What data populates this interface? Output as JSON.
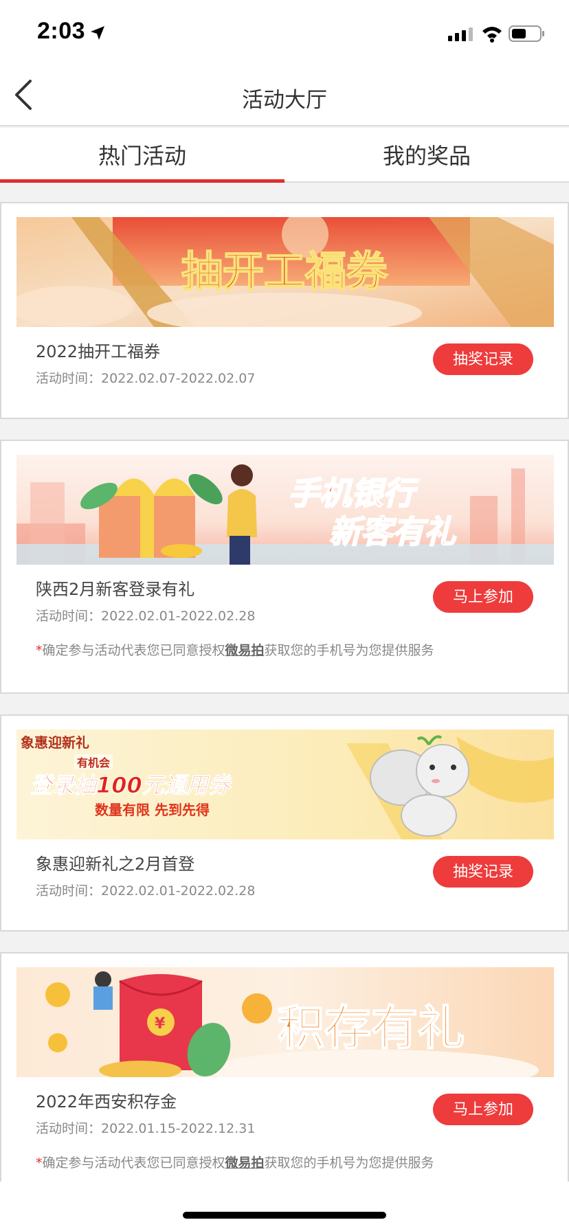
{
  "status": {
    "time": "2:03",
    "icons": [
      "location-arrow-icon",
      "signal-icon",
      "wifi-icon",
      "battery-icon"
    ]
  },
  "nav": {
    "title": "活动大厅",
    "back_icon": "chevron-left-icon"
  },
  "tabs": [
    {
      "label": "热门活动",
      "active": true
    },
    {
      "label": "我的奖品",
      "active": false
    }
  ],
  "activities": [
    {
      "banner_text": "抽开工福券",
      "title": "2022抽开工福券",
      "time_label": "活动时间：",
      "time_range": "2022.02.07-2022.02.07",
      "button": "抽奖记录",
      "note": null
    },
    {
      "banner_text_1": "手机银行",
      "banner_text_2": "新客有礼",
      "title": "陕西2月新客登录有礼",
      "time_label": "活动时间：",
      "time_range": "2022.02.01-2022.02.28",
      "button": "马上参加",
      "note": {
        "star": "*",
        "before": "确定参与活动代表您已同意授权",
        "link": "微易拍",
        "after": "获取您的手机号为您提供服务"
      }
    },
    {
      "banner_badge": "象惠迎新礼",
      "banner_small": "有机会",
      "banner_main": "登录抽100元通用券",
      "banner_sub": "数量有限 先到先得",
      "title": "象惠迎新礼之2月首登",
      "time_label": "活动时间：",
      "time_range": "2022.02.01-2022.02.28",
      "button": "抽奖记录",
      "note": null
    },
    {
      "banner_text": "积存有礼",
      "title": "2022年西安积存金",
      "time_label": "活动时间：",
      "time_range": "2022.01.15-2022.12.31",
      "button": "马上参加",
      "note": {
        "star": "*",
        "before": "确定参与活动代表您已同意授权",
        "link": "微易拍",
        "after": "获取您的手机号为您提供服务"
      }
    }
  ],
  "colors": {
    "accent": "#e02d2d",
    "button": "#ee3b3b"
  }
}
